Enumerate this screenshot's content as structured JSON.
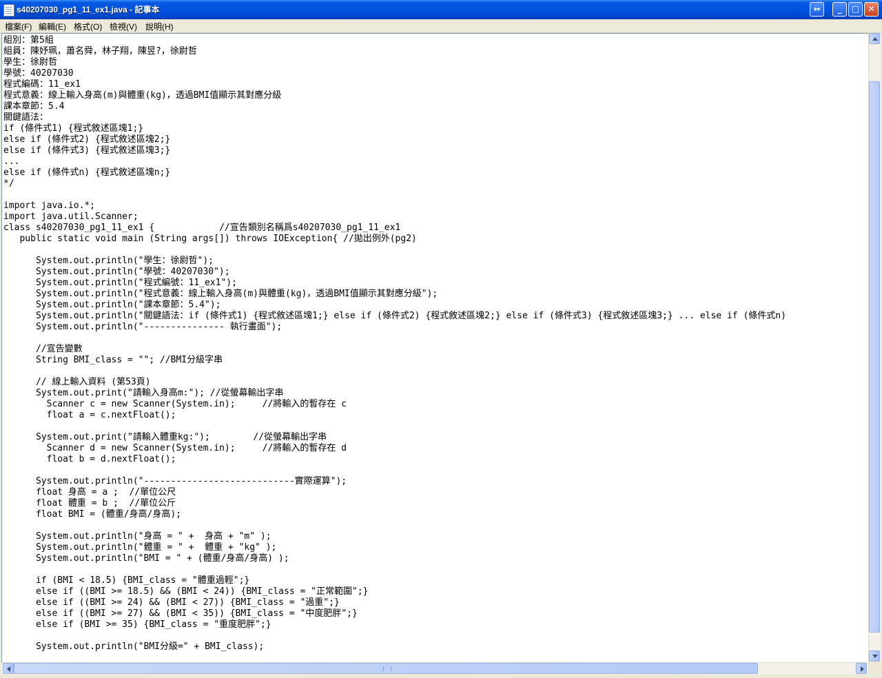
{
  "window": {
    "title": "s40207030_pg1_11_ex1.java - 記事本"
  },
  "titlebar": {
    "restore_glyph": "⇔",
    "min_glyph": "_",
    "max_glyph": "□",
    "close_glyph": "✕"
  },
  "menu": [
    {
      "label": "檔案(F)"
    },
    {
      "label": "編輯(E)"
    },
    {
      "label": "格式(O)"
    },
    {
      "label": "檢視(V)"
    },
    {
      "label": "說明(H)"
    }
  ],
  "icons": {
    "app": "notepad-icon",
    "scroll_up": "arrow-up-icon",
    "scroll_down": "arrow-down-icon",
    "scroll_left": "arrow-left-icon",
    "scroll_right": "arrow-right-icon"
  },
  "editor": {
    "lines": [
      "組別：第5組",
      "組員：陳妤珮，蕭名舜，林子翔，陳昱?，徐尉哲",
      "學生：徐尉哲",
      "學號：40207030",
      "程式編碼：11_ex1",
      "程式意義：線上輸入身高(m)與體重(kg)，透過BMI值顯示其對應分級",
      "課本章節：5.4",
      "關鍵語法：",
      "if (條件式1) {程式敘述區塊1;}",
      "else if (條件式2) {程式敘述區塊2;}",
      "else if (條件式3) {程式敘述區塊3;}",
      "...",
      "else if (條件式n) {程式敘述區塊n;}",
      "*/",
      "",
      "import java.io.*;",
      "import java.util.Scanner;",
      "class s40207030_pg1_11_ex1 {            //宣告類別名稱爲s40207030_pg1_11_ex1",
      "   public static void main (String args[]) throws IOException{ //拋出例外(pg2)",
      "",
      "      System.out.println(\"學生：徐尉哲\");",
      "      System.out.println(\"學號：40207030\");",
      "      System.out.println(\"程式編號：11_ex1\");",
      "      System.out.println(\"程式意義：線上輸入身高(m)與體重(kg)，透過BMI值顯示其對應分級\");",
      "      System.out.println(\"課本章節：5.4\");",
      "      System.out.println(\"關鍵語法：if (條件式1) {程式敘述區塊1;} else if (條件式2) {程式敘述區塊2;} else if (條件式3) {程式敘述區塊3;} ... else if (條件式n)",
      "      System.out.println(\"--------------- 執行畫面\");",
      "",
      "      //宣告變數",
      "      String BMI_class = \"\"; //BMI分級字串",
      "",
      "      // 線上輸入資料 (第53頁)",
      "      System.out.print(\"請輸入身高m:\"); //從螢幕輸出字串",
      "        Scanner c = new Scanner(System.in);     //將輸入的暫存在 c",
      "        float a = c.nextFloat();",
      "",
      "      System.out.print(\"請輸入體重kg:\");        //從螢幕輸出字串",
      "        Scanner d = new Scanner(System.in);     //將輸入的暫存在 d",
      "        float b = d.nextFloat();",
      "",
      "      System.out.println(\"----------------------------實際運算\");",
      "      float 身高 = a ;  //單位公尺",
      "      float 體重 = b ;  //單位公斤",
      "      float BMI = (體重/身高/身高);",
      "",
      "      System.out.println(\"身高 = \" +  身高 + \"m\" );",
      "      System.out.println(\"體重 = \" +  體重 + \"kg\" );",
      "      System.out.println(\"BMI = \" + (體重/身高/身高) );",
      "",
      "      if (BMI < 18.5) {BMI_class = \"體重過輕\";}",
      "      else if ((BMI >= 18.5) && (BMI < 24)) {BMI_class = \"正常範圍\";}",
      "      else if ((BMI >= 24) && (BMI < 27)) {BMI_class = \"過重\";}",
      "      else if ((BMI >= 27) && (BMI < 35)) {BMI_class = \"中度肥胖\";}",
      "      else if (BMI >= 35) {BMI_class = \"重度肥胖\";}",
      "",
      "      System.out.println(\"BMI分級=\" + BMI_class);"
    ]
  }
}
